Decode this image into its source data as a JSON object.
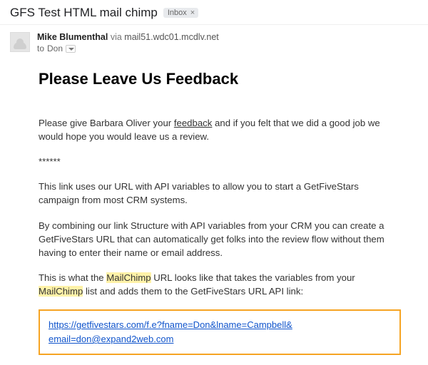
{
  "subject": "GFS Test HTML mail chimp",
  "label": {
    "name": "Inbox"
  },
  "from": {
    "sender": "Mike Blumenthal",
    "via_label": "via",
    "via_host": "mail51.wdc01.mcdlv.net"
  },
  "to": {
    "prefix": "to",
    "recipient": "Don"
  },
  "message": {
    "heading": "Please Leave Us Feedback",
    "p1_a": "Please give Barbara Oliver your ",
    "p1_link": "feedback",
    "p1_b": " and if you felt that we did a good job we would hope you would leave us a review.",
    "divider": "******",
    "p2": "This link uses our URL with API variables to allow you to start a GetFiveStars campaign from most CRM systems.",
    "p3": "By combining our link Structure with API variables from your CRM you can create a GetFiveStars URL that can automatically get folks into the review flow without them having to enter their name or email address.",
    "p4_a": "This is what the ",
    "p4_hl1": "MailChimp",
    "p4_b": " URL looks like that takes the variables from your ",
    "p4_hl2": "MailChimp",
    "p4_c": " list and adds them to the GetFiveStars URL API link:",
    "url_line1": "https://getfivestars.com/f.e?fname=Don&lname=Campbell&",
    "url_line2": "email=don@expand2web.com"
  }
}
